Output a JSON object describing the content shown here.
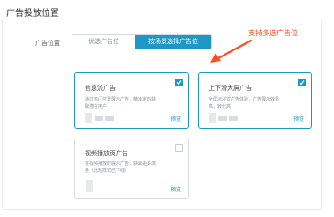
{
  "section": {
    "title": "广告投放位置"
  },
  "field": {
    "label": "广告位置"
  },
  "segment": {
    "options": [
      {
        "label": "优选广告位",
        "selected": false
      },
      {
        "label": "按场景选择广告位",
        "selected": true
      }
    ]
  },
  "annotation": {
    "text": "支持多选广告位",
    "color": "#ff4b1f"
  },
  "cards": [
    {
      "title": "信息流广告",
      "desc_lines": [
        "通过热门位置展示广告，精准定向获",
        "取潜在用户"
      ],
      "preview": "预览",
      "checked": true
    },
    {
      "title": "上下滑大屏广告",
      "desc_lines": [
        "全屏沉浸式广告体验，广告展示效果",
        "高，转化高"
      ],
      "preview": "预览",
      "checked": true
    },
    {
      "title": "视频播放页广告",
      "desc_lines": [
        "在视频播放时展示广告，获取更多流",
        "量（此短样式已下线）"
      ],
      "preview": "预览",
      "checked": false
    }
  ],
  "colors": {
    "accent": "#1c97c6",
    "border": "#d9dce1"
  },
  "icons": {
    "check": "check-icon",
    "arrow": "arrow-icon"
  }
}
